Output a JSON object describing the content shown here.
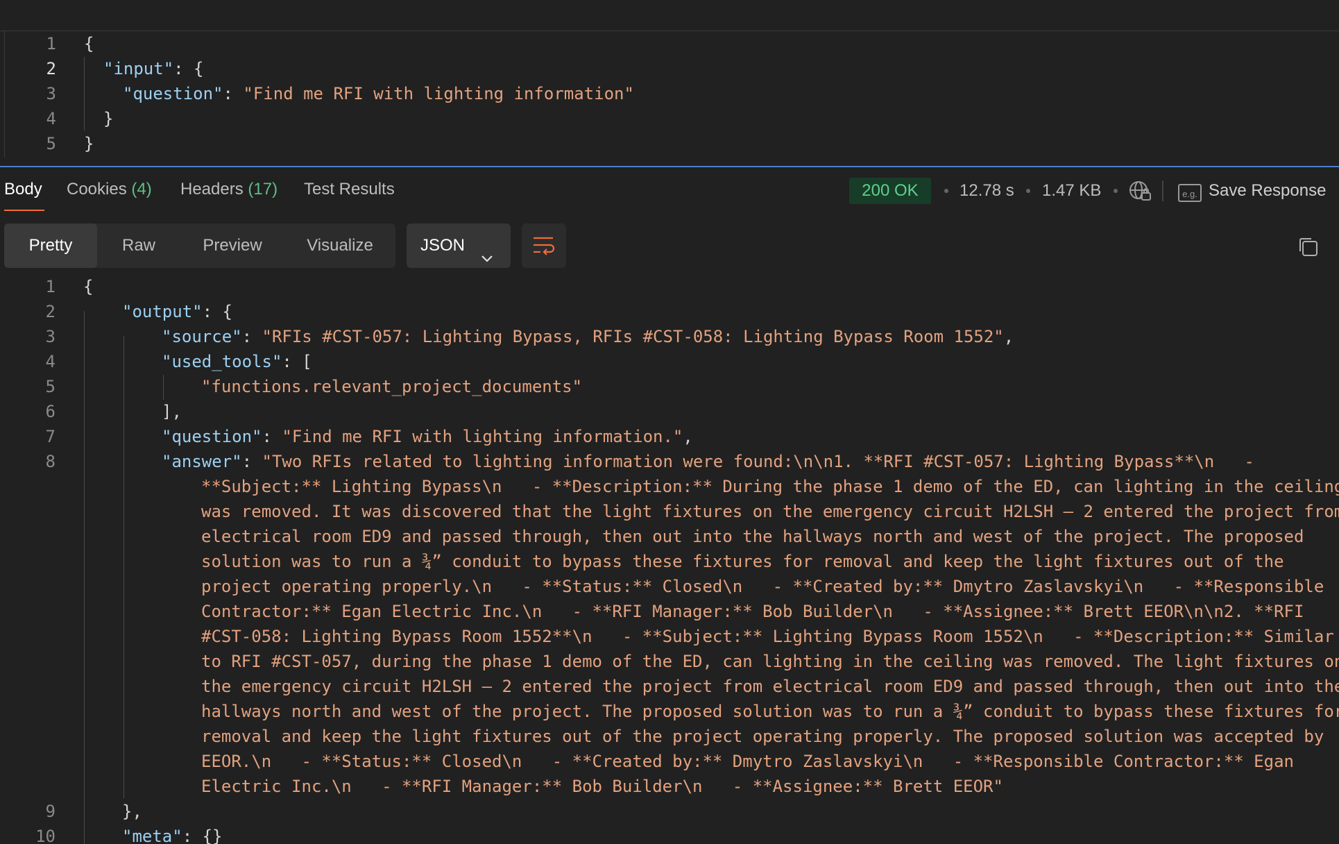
{
  "request_body": {
    "lines": [
      {
        "n": "1",
        "tokens": [
          {
            "t": "pun",
            "v": "{"
          }
        ]
      },
      {
        "n": "2",
        "tokens": [
          {
            "t": "key",
            "v": "\"input\""
          },
          {
            "t": "pun",
            "v": ": {"
          }
        ]
      },
      {
        "n": "3",
        "tokens": [
          {
            "t": "key",
            "v": "\"question\""
          },
          {
            "t": "pun",
            "v": ": "
          },
          {
            "t": "str",
            "v": "\"Find me RFI with lighting information\""
          }
        ]
      },
      {
        "n": "4",
        "tokens": [
          {
            "t": "pun",
            "v": "}"
          }
        ]
      },
      {
        "n": "5",
        "tokens": [
          {
            "t": "pun",
            "v": "}"
          }
        ]
      }
    ]
  },
  "response_tabs": [
    {
      "label": "Body",
      "count": ""
    },
    {
      "label": "Cookies",
      "count": "(4)"
    },
    {
      "label": "Headers",
      "count": "(17)"
    },
    {
      "label": "Test Results",
      "count": ""
    }
  ],
  "status": {
    "code": "200 OK",
    "time": "12.78 s",
    "size": "1.47 KB",
    "save_label": "Save Response"
  },
  "view_modes": [
    "Pretty",
    "Raw",
    "Preview",
    "Visualize"
  ],
  "format": "JSON",
  "response_body": {
    "lines": [
      {
        "n": "1",
        "wrapped": false,
        "tokens": [
          {
            "t": "pun",
            "v": "{"
          }
        ]
      },
      {
        "n": "2",
        "wrapped": false,
        "tokens": [
          {
            "t": "key",
            "v": "\"output\""
          },
          {
            "t": "pun",
            "v": ": {"
          }
        ]
      },
      {
        "n": "3",
        "wrapped": false,
        "tokens": [
          {
            "t": "key",
            "v": "\"source\""
          },
          {
            "t": "pun",
            "v": ": "
          },
          {
            "t": "str",
            "v": "\"RFIs #CST-057: Lighting Bypass, RFIs #CST-058: Lighting Bypass Room 1552\""
          },
          {
            "t": "pun",
            "v": ","
          }
        ]
      },
      {
        "n": "4",
        "wrapped": false,
        "tokens": [
          {
            "t": "key",
            "v": "\"used_tools\""
          },
          {
            "t": "pun",
            "v": ": ["
          }
        ]
      },
      {
        "n": "5",
        "wrapped": false,
        "tokens": [
          {
            "t": "str",
            "v": "\"functions.relevant_project_documents\""
          }
        ]
      },
      {
        "n": "6",
        "wrapped": false,
        "tokens": [
          {
            "t": "pun",
            "v": "],"
          }
        ]
      },
      {
        "n": "7",
        "wrapped": false,
        "tokens": [
          {
            "t": "key",
            "v": "\"question\""
          },
          {
            "t": "pun",
            "v": ": "
          },
          {
            "t": "str",
            "v": "\"Find me RFI with lighting information.\""
          },
          {
            "t": "pun",
            "v": ","
          }
        ]
      },
      {
        "n": "8",
        "wrapped": false,
        "tokens": [
          {
            "t": "key",
            "v": "\"answer\""
          },
          {
            "t": "pun",
            "v": ": "
          },
          {
            "t": "str",
            "v": "\"Two RFIs related to lighting information were found:\\n\\n1. **RFI #CST-057: Lighting Bypass**\\n   -"
          }
        ]
      },
      {
        "n": "",
        "wrapped": true,
        "tokens": [
          {
            "t": "str",
            "v": "**Subject:** Lighting Bypass\\n   - **Description:** During the phase 1 demo of the ED, can lighting in the ceiling"
          }
        ]
      },
      {
        "n": "",
        "wrapped": true,
        "tokens": [
          {
            "t": "str",
            "v": "was removed. It was discovered that the light fixtures on the emergency circuit H2LSH – 2 entered the project from"
          }
        ]
      },
      {
        "n": "",
        "wrapped": true,
        "tokens": [
          {
            "t": "str",
            "v": "electrical room ED9 and passed through, then out into the hallways north and west of the project. The proposed"
          }
        ]
      },
      {
        "n": "",
        "wrapped": true,
        "tokens": [
          {
            "t": "str",
            "v": "solution was to run a ¾” conduit to bypass these fixtures for removal and keep the light fixtures out of the"
          }
        ]
      },
      {
        "n": "",
        "wrapped": true,
        "tokens": [
          {
            "t": "str",
            "v": "project operating properly.\\n   - **Status:** Closed\\n   - **Created by:** Dmytro Zaslavskyi\\n   - **Responsible"
          }
        ]
      },
      {
        "n": "",
        "wrapped": true,
        "tokens": [
          {
            "t": "str",
            "v": "Contractor:** Egan Electric Inc.\\n   - **RFI Manager:** Bob Builder\\n   - **Assignee:** Brett EEOR\\n\\n2. **RFI"
          }
        ]
      },
      {
        "n": "",
        "wrapped": true,
        "tokens": [
          {
            "t": "str",
            "v": "#CST-058: Lighting Bypass Room 1552**\\n   - **Subject:** Lighting Bypass Room 1552\\n   - **Description:** Similar"
          }
        ]
      },
      {
        "n": "",
        "wrapped": true,
        "tokens": [
          {
            "t": "str",
            "v": "to RFI #CST-057, during the phase 1 demo of the ED, can lighting in the ceiling was removed. The light fixtures on"
          }
        ]
      },
      {
        "n": "",
        "wrapped": true,
        "tokens": [
          {
            "t": "str",
            "v": "the emergency circuit H2LSH – 2 entered the project from electrical room ED9 and passed through, then out into the"
          }
        ]
      },
      {
        "n": "",
        "wrapped": true,
        "tokens": [
          {
            "t": "str",
            "v": "hallways north and west of the project. The proposed solution was to run a ¾” conduit to bypass these fixtures for"
          }
        ]
      },
      {
        "n": "",
        "wrapped": true,
        "tokens": [
          {
            "t": "str",
            "v": "removal and keep the light fixtures out of the project operating properly. The proposed solution was accepted by"
          }
        ]
      },
      {
        "n": "",
        "wrapped": true,
        "tokens": [
          {
            "t": "str",
            "v": "EEOR.\\n   - **Status:** Closed\\n   - **Created by:** Dmytro Zaslavskyi\\n   - **Responsible Contractor:** Egan"
          }
        ]
      },
      {
        "n": "",
        "wrapped": true,
        "tokens": [
          {
            "t": "str",
            "v": "Electric Inc.\\n   - **RFI Manager:** Bob Builder\\n   - **Assignee:** Brett EEOR\""
          }
        ]
      },
      {
        "n": "9",
        "wrapped": false,
        "tokens": [
          {
            "t": "pun",
            "v": "},"
          }
        ]
      },
      {
        "n": "10",
        "wrapped": false,
        "tokens": [
          {
            "t": "key",
            "v": "\"meta\""
          },
          {
            "t": "pun",
            "v": ": {}"
          }
        ]
      }
    ]
  }
}
